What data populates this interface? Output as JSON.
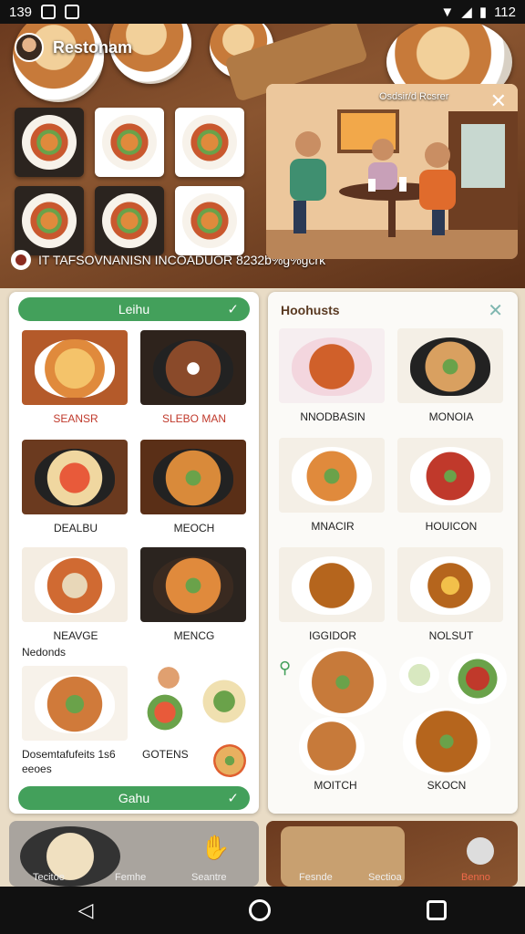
{
  "status": {
    "time": "139",
    "clock": "112"
  },
  "header": {
    "brand": "Restonam"
  },
  "scene": {
    "title": "Osdsir/d Rcsrer"
  },
  "hero": {
    "caption": "IT TAFSOVNANISN INCOADUOR 8232b%g%gcrk"
  },
  "left_panel": {
    "top_pill": "Leihu",
    "items": [
      {
        "name": "SEANSR",
        "color": "#c0392b"
      },
      {
        "name": "SLEBO MAN",
        "color": "#c0392b"
      },
      {
        "name": "DEALBU"
      },
      {
        "name": "MEOCH"
      },
      {
        "name": "NEAVGE"
      },
      {
        "name": "MENCG"
      }
    ],
    "section": "Nedonds",
    "featured_caption_1": "Dosemtafufeits 1s6",
    "featured_caption_2": "eeoes",
    "featured_side": "GOTENS",
    "bottom_pill": "Gahu"
  },
  "right_panel": {
    "title": "Hoohusts",
    "items": [
      {
        "name": "NNODBASIN"
      },
      {
        "name": "MONOIA"
      },
      {
        "name": "MNACIR"
      },
      {
        "name": "HOUICON"
      },
      {
        "name": "IGGIDOR"
      },
      {
        "name": "NOLSUT"
      },
      {
        "name": "MOITCH"
      },
      {
        "name": "SKOCN"
      }
    ]
  },
  "bottom_nav": {
    "left": [
      "Tecitoe",
      "Femhe",
      "Seantre"
    ],
    "right": [
      "Fesnde",
      "Sectioa",
      "Benno"
    ]
  }
}
